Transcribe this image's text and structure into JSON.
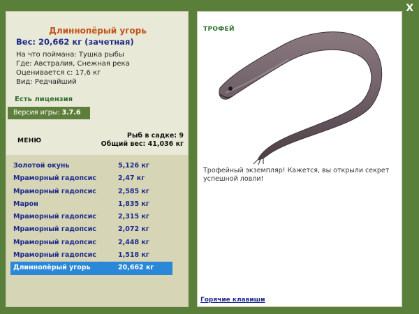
{
  "fish": {
    "name": "Длиннопёрый угорь",
    "weight_line": "Вес: 20,662 кг (зачетная)",
    "bait": "На что поймана: Тушка рыбы",
    "location": "Где: Австралия, Снежная река",
    "value": "Оценивается с: 17,6 кг",
    "rarity": "Вид: Редчайший"
  },
  "license": "Есть лицензия",
  "version": {
    "label": "Версия игры: ",
    "number": "3.7.6"
  },
  "menu_label": "МЕНЮ",
  "tank": {
    "count_line": "Рыб в садке: 9",
    "total_line": "Общий вес: 41,036 кг"
  },
  "catches": [
    {
      "name": "Золотой окунь",
      "weight": "5,126 кг"
    },
    {
      "name": "Мраморный гадопсис",
      "weight": "2,47 кг"
    },
    {
      "name": "Мраморный гадопсис",
      "weight": "2,585 кг"
    },
    {
      "name": "Марон",
      "weight": "1,835 кг"
    },
    {
      "name": "Мраморный гадопсис",
      "weight": "2,315 кг"
    },
    {
      "name": "Мраморный гадопсис",
      "weight": "2,072 кг"
    },
    {
      "name": "Мраморный гадопсис",
      "weight": "2,448 кг"
    },
    {
      "name": "Мраморный гадопсис",
      "weight": "1,518 кг"
    },
    {
      "name": "Длиннопёрый угорь",
      "weight": "20,662 кг"
    }
  ],
  "selected_catch_index": 8,
  "trophy": {
    "title": "ТРОФЕЙ",
    "text": "Трофейный экземпляр! Кажется, вы открыли секрет успешной ловли!"
  },
  "hotkeys_label": "Горячие клавиши",
  "close_label": "X",
  "colors": {
    "background": "#5a7f3a",
    "panel": "#e9e9d8",
    "list_area": "#d6d6b6",
    "name_accent": "#c2531c",
    "text_blue": "#1d2a8c",
    "selected_row": "#2b87d8"
  },
  "icons": {
    "close": "close-icon",
    "trophy_image": "eel-fish-image"
  }
}
